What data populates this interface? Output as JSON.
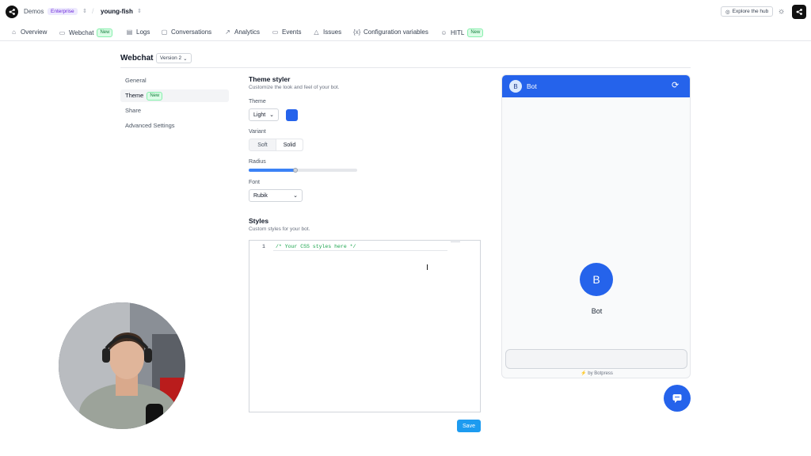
{
  "topbar": {
    "workspace": "Demos",
    "plan": "Enterprise",
    "separator": "/",
    "bot_name": "young-fish",
    "explore_hub": "Explore the hub"
  },
  "nav": {
    "items": [
      {
        "label": "Overview",
        "icon": "home-icon"
      },
      {
        "label": "Webchat",
        "icon": "chat-bubble-icon",
        "badge": "New"
      },
      {
        "label": "Logs",
        "icon": "logs-icon"
      },
      {
        "label": "Conversations",
        "icon": "conversations-icon"
      },
      {
        "label": "Analytics",
        "icon": "analytics-icon"
      },
      {
        "label": "Events",
        "icon": "events-icon"
      },
      {
        "label": "Issues",
        "icon": "warning-icon"
      },
      {
        "label": "Configuration variables",
        "icon": "braces-icon"
      },
      {
        "label": "HITL",
        "icon": "users-icon",
        "badge": "New"
      }
    ]
  },
  "page": {
    "title": "Webchat",
    "version": "Version 2"
  },
  "settings_nav": {
    "items": [
      {
        "label": "General"
      },
      {
        "label": "Theme",
        "badge": "New",
        "active": true
      },
      {
        "label": "Share"
      },
      {
        "label": "Advanced Settings"
      }
    ]
  },
  "theme_styler": {
    "title": "Theme styler",
    "subtitle": "Customize the look and feel of your bot.",
    "theme_label": "Theme",
    "theme_value": "Light",
    "accent_color": "#2563eb",
    "variant_label": "Variant",
    "variant_options": [
      "Soft",
      "Solid"
    ],
    "variant_selected": "Solid",
    "radius_label": "Radius",
    "radius_value_fraction": 0.43,
    "font_label": "Font",
    "font_value": "Rubik"
  },
  "styles": {
    "title": "Styles",
    "subtitle": "Custom styles for your bot.",
    "line_number": "1",
    "code": "/* Your CSS styles here */",
    "save_label": "Save"
  },
  "preview": {
    "header_avatar": "B",
    "header_title": "Bot",
    "big_avatar": "B",
    "bot_name": "Bot",
    "footer_bolt": "⚡",
    "footer": "by Botpress",
    "header_color": "#2563eb"
  }
}
